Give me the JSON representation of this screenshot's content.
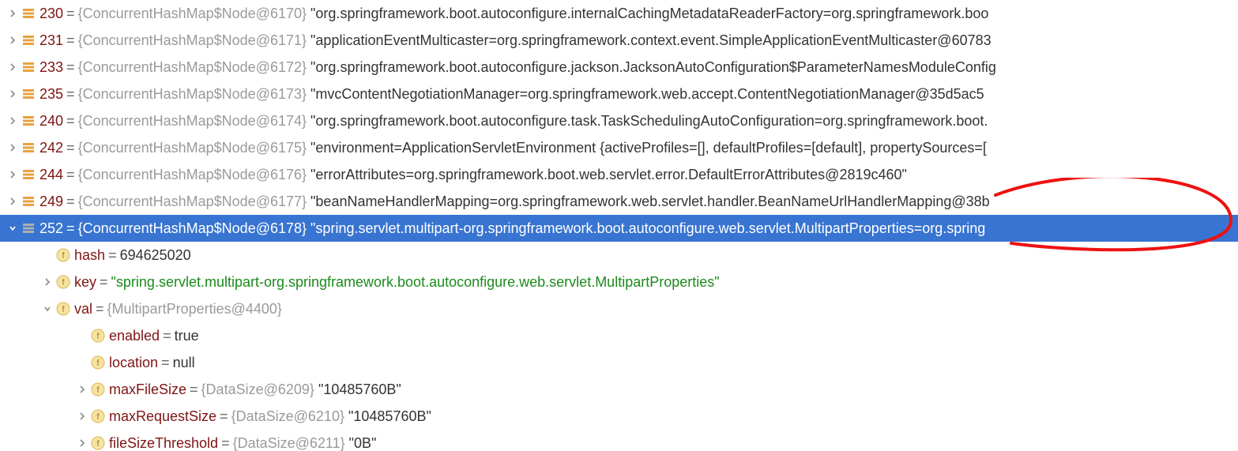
{
  "nodeType": "ConcurrentHashMap$Node",
  "rows": [
    {
      "idx": "230",
      "id": "6170",
      "val": "\"org.springframework.boot.autoconfigure.internalCachingMetadataReaderFactory=org.springframework.boo"
    },
    {
      "idx": "231",
      "id": "6171",
      "val": "\"applicationEventMulticaster=org.springframework.context.event.SimpleApplicationEventMulticaster@60783"
    },
    {
      "idx": "233",
      "id": "6172",
      "val": "\"org.springframework.boot.autoconfigure.jackson.JacksonAutoConfiguration$ParameterNamesModuleConfig"
    },
    {
      "idx": "235",
      "id": "6173",
      "val": "\"mvcContentNegotiationManager=org.springframework.web.accept.ContentNegotiationManager@35d5ac5"
    },
    {
      "idx": "240",
      "id": "6174",
      "val": "\"org.springframework.boot.autoconfigure.task.TaskSchedulingAutoConfiguration=org.springframework.boot."
    },
    {
      "idx": "242",
      "id": "6175",
      "val": "\"environment=ApplicationServletEnvironment {activeProfiles=[], defaultProfiles=[default], propertySources=["
    },
    {
      "idx": "244",
      "id": "6176",
      "val": "\"errorAttributes=org.springframework.boot.web.servlet.error.DefaultErrorAttributes@2819c460\""
    },
    {
      "idx": "249",
      "id": "6177",
      "val": "\"beanNameHandlerMapping=org.springframework.web.servlet.handler.BeanNameUrlHandlerMapping@38b"
    }
  ],
  "selected": {
    "idx": "252",
    "id": "6178",
    "val": "\"spring.servlet.multipart-org.springframework.boot.autoconfigure.web.servlet.MultipartProperties=org.spring"
  },
  "fields": {
    "hash": {
      "label": "hash",
      "value": "694625020"
    },
    "key": {
      "label": "key",
      "value": "\"spring.servlet.multipart-org.springframework.boot.autoconfigure.web.servlet.MultipartProperties\""
    },
    "val": {
      "label": "val",
      "type": "{MultipartProperties@4400}"
    },
    "enabled": {
      "label": "enabled",
      "value": "true"
    },
    "location": {
      "label": "location",
      "value": "null"
    },
    "maxFileSize": {
      "label": "maxFileSize",
      "type": "{DataSize@6209}",
      "value": "\"10485760B\""
    },
    "maxRequestSize": {
      "label": "maxRequestSize",
      "type": "{DataSize@6210}",
      "value": "\"10485760B\""
    },
    "fileSizeThreshold": {
      "label": "fileSizeThreshold",
      "type": "{DataSize@6211}",
      "value": "\"0B\""
    }
  }
}
